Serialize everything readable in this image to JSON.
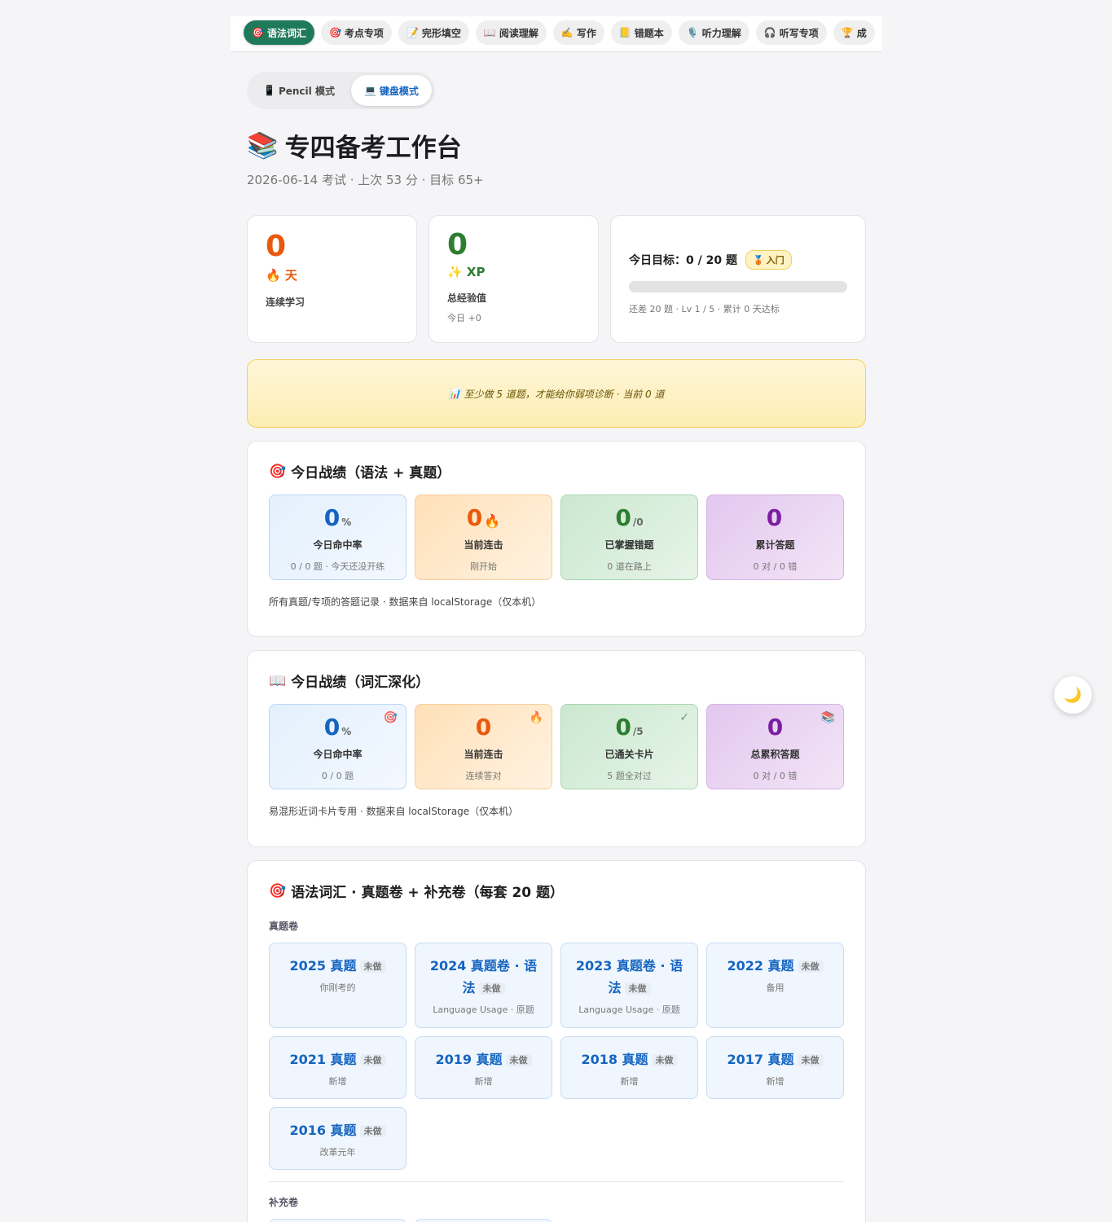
{
  "nav": {
    "tabs": [
      {
        "icon": "🎯",
        "label": "语法词汇",
        "active": true
      },
      {
        "icon": "🎯",
        "label": "考点专项"
      },
      {
        "icon": "📝",
        "label": "完形填空"
      },
      {
        "icon": "📖",
        "label": "阅读理解"
      },
      {
        "icon": "✍️",
        "label": "写作"
      },
      {
        "icon": "📒",
        "label": "错题本"
      },
      {
        "icon": "🎙️",
        "label": "听力理解"
      },
      {
        "icon": "🎧",
        "label": "听写专项"
      },
      {
        "icon": "🏆",
        "label": "成"
      }
    ]
  },
  "mode": {
    "pencil": {
      "icon": "📱",
      "label": "Pencil 模式"
    },
    "keyboard": {
      "icon": "💻",
      "label": "键盘模式"
    }
  },
  "header": {
    "icon": "📚",
    "title": "专四备考工作台",
    "subtitle": "2026-06-14 考试 · 上次 53 分 · 目标 65+"
  },
  "stats": {
    "streak": {
      "value": "0",
      "unit_icon": "🔥",
      "unit": "天",
      "label": "连续学习"
    },
    "xp": {
      "value": "0",
      "unit_icon": "✨",
      "unit": "XP",
      "label": "总经验值",
      "sub": "今日 +0"
    },
    "goal": {
      "label": "今日目标：",
      "value": "0 / 20 题",
      "badge_icon": "🥉",
      "badge": "入门",
      "progress": 0,
      "sub": "还差 20 题 · Lv 1 / 5 · 累计 0 天达标"
    }
  },
  "banner": {
    "icon": "📊",
    "text": "至少做 5 道题，才能给你弱项诊断 · 当前 0 道"
  },
  "grammar_today": {
    "icon": "🎯",
    "title": "今日战绩（语法 + 真题）",
    "metrics": [
      {
        "value": "0",
        "suffix": "%",
        "label": "今日命中率",
        "sub": "0 / 0 题 · 今天还没开练"
      },
      {
        "value": "0",
        "suffix": "🔥",
        "label": "当前连击",
        "sub": "刚开始"
      },
      {
        "value": "0",
        "suffix": "/0",
        "label": "已掌握错题",
        "sub": "0 道在路上"
      },
      {
        "value": "0",
        "suffix": "",
        "label": "累计答题",
        "sub": "0 对 / 0 错"
      }
    ],
    "note": "所有真题/专项的答题记录 · 数据来自 localStorage（仅本机）"
  },
  "vocab_today": {
    "icon": "📖",
    "title": "今日战绩（词汇深化）",
    "metrics": [
      {
        "value": "0",
        "suffix": "%",
        "label": "今日命中率",
        "sub": "0 / 0 题",
        "corner": "🎯"
      },
      {
        "value": "0",
        "suffix": "",
        "label": "当前连击",
        "sub": "连续答对",
        "corner": "🔥"
      },
      {
        "value": "0",
        "suffix": "/5",
        "label": "已通关卡片",
        "sub": "5 题全对过",
        "corner": "✓"
      },
      {
        "value": "0",
        "suffix": "",
        "label": "总累积答题",
        "sub": "0 对 / 0 错",
        "corner": "📚"
      }
    ],
    "note": "易混形近词卡片专用 · 数据来自 localStorage（仅本机）"
  },
  "papers": {
    "icon": "🎯",
    "title": "语法词汇 · 真题卷 + 补充卷（每套 20 题）",
    "real_label": "真题卷",
    "status": "未做",
    "real": [
      {
        "title": "2025 真题",
        "sub": "你刚考的"
      },
      {
        "title": "2024 真题卷 · 语法",
        "sub": "Language Usage · 原题"
      },
      {
        "title": "2023 真题卷 · 语法",
        "sub": "Language Usage · 原题"
      },
      {
        "title": "2022 真题",
        "sub": "备用"
      },
      {
        "title": "2021 真题",
        "sub": "新增"
      },
      {
        "title": "2019 真题",
        "sub": "新增"
      },
      {
        "title": "2018 真题",
        "sub": "新增"
      },
      {
        "title": "2017 真题",
        "sub": "新增"
      },
      {
        "title": "2016 真题",
        "sub": "改革元年"
      }
    ],
    "supp_label": "补充卷"
  },
  "theme_toggle": {
    "icon": "🌙"
  },
  "colors": {
    "accent": "#1f7a5a",
    "link": "#1565c0",
    "streak": "#e8590c",
    "xp": "#2e7d32"
  }
}
